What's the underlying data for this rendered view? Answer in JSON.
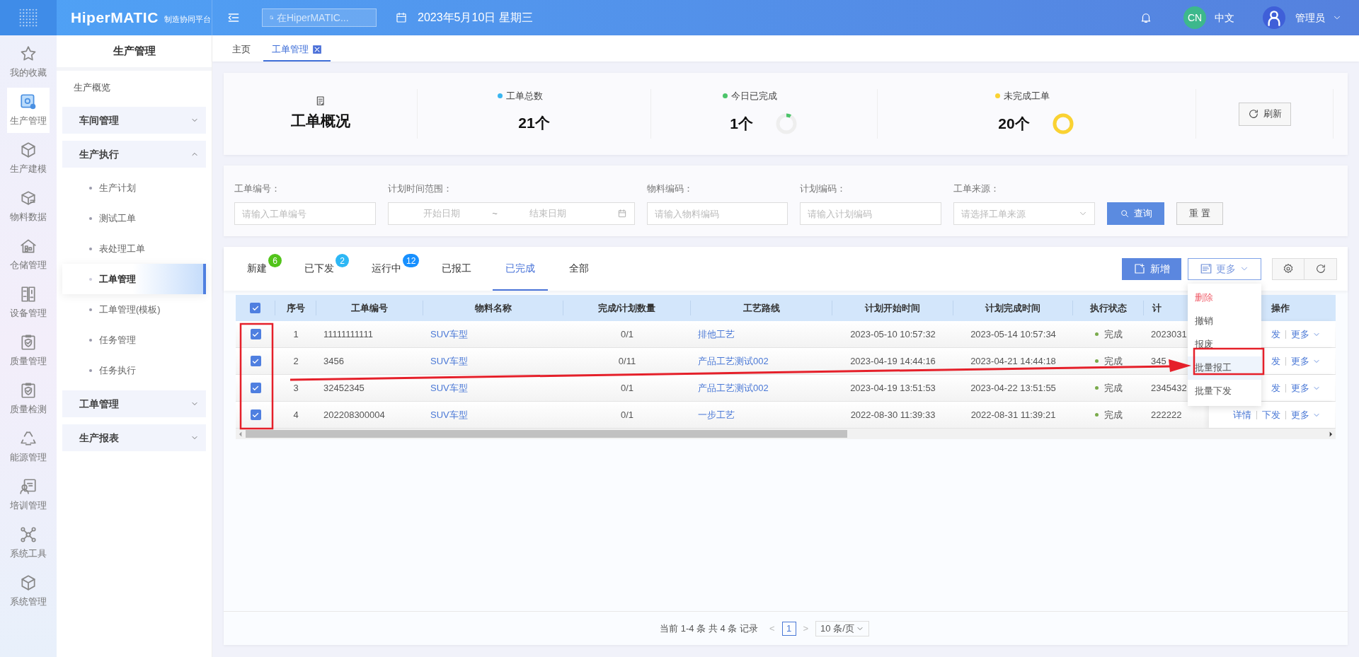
{
  "header": {
    "brand": "HiperMATIC",
    "brand_subtitle": "制造协同平台",
    "search": {
      "placeholder": "在HiperMATIC..."
    },
    "date": "2023年5月10日 星期三",
    "language_badge": "CN",
    "language": "中文",
    "user": "管理员"
  },
  "rail": [
    {
      "label": "我的收藏",
      "selected": false
    },
    {
      "label": "生产管理",
      "selected": true
    },
    {
      "label": "生产建模",
      "selected": false
    },
    {
      "label": "物料数据",
      "selected": false
    },
    {
      "label": "仓储管理",
      "selected": false
    },
    {
      "label": "设备管理",
      "selected": false
    },
    {
      "label": "质量管理",
      "selected": false
    },
    {
      "label": "质量检测",
      "selected": false
    },
    {
      "label": "能源管理",
      "selected": false
    },
    {
      "label": "培训管理",
      "selected": false
    },
    {
      "label": "系统工具",
      "selected": false
    },
    {
      "label": "系统管理",
      "selected": false
    }
  ],
  "sidebar": {
    "title": "生产管理",
    "items": [
      {
        "label": "生产概览",
        "kind": "link"
      },
      {
        "label": "车间管理",
        "kind": "group",
        "expanded": false
      },
      {
        "label": "生产执行",
        "kind": "group",
        "expanded": true,
        "children": [
          {
            "label": "生产计划",
            "selected": false
          },
          {
            "label": "测试工单",
            "selected": false
          },
          {
            "label": "表处理工单",
            "selected": false
          },
          {
            "label": "工单管理",
            "selected": true
          },
          {
            "label": "工单管理(模板)",
            "selected": false
          },
          {
            "label": "任务管理",
            "selected": false
          },
          {
            "label": "任务执行",
            "selected": false
          }
        ]
      },
      {
        "label": "工单管理",
        "kind": "group",
        "expanded": false
      },
      {
        "label": "生产报表",
        "kind": "group",
        "expanded": false
      }
    ]
  },
  "page_tabs": [
    {
      "label": "主页",
      "selected": false,
      "closable": false
    },
    {
      "label": "工单管理",
      "selected": true,
      "closable": true
    }
  ],
  "overview": {
    "title": "工单概况",
    "stats": [
      {
        "label": "工单总数",
        "value": "21个",
        "color": "#3ab5f0"
      },
      {
        "label": "今日已完成",
        "value": "1个",
        "color": "#4cc46a",
        "level": 0.08
      },
      {
        "label": "未完成工单",
        "value": "20个",
        "color": "#fad232",
        "level": 1
      }
    ],
    "refresh": "刷新"
  },
  "filters": [
    {
      "label": "工单编号：",
      "kind": "text",
      "placeholder": "请输入工单编号"
    },
    {
      "label": "计划时间范围：",
      "kind": "daterange",
      "start_placeholder": "开始日期",
      "separator": "~",
      "end_placeholder": "结束日期"
    },
    {
      "label": "物料编码：",
      "kind": "text",
      "placeholder": "请输入物料编码"
    },
    {
      "label": "计划编码：",
      "kind": "text",
      "placeholder": "请输入计划编码"
    },
    {
      "label": "工单来源：",
      "kind": "select",
      "placeholder": "请选择工单来源"
    }
  ],
  "filter_buttons": {
    "search": "查询",
    "reset": "重 置"
  },
  "status_tabs": [
    {
      "label": "新建",
      "badge": "6",
      "color": "#52c41a",
      "selected": false
    },
    {
      "label": "已下发",
      "badge": "2",
      "color": "#2db7f5",
      "selected": false
    },
    {
      "label": "运行中",
      "badge": "12",
      "color": "#1890ff",
      "selected": false
    },
    {
      "label": "已报工",
      "selected": false
    },
    {
      "label": "已完成",
      "selected": true
    },
    {
      "label": "全部",
      "selected": false
    }
  ],
  "toolbar": {
    "add": "新增",
    "more": "更多",
    "menu": [
      {
        "label": "删除",
        "kind": "danger",
        "highlighted": false
      },
      {
        "label": "撤销",
        "kind": "normal",
        "highlighted": false
      },
      {
        "label": "报废",
        "kind": "normal",
        "highlighted": false
      },
      {
        "label": "批量报工",
        "kind": "normal",
        "highlighted": true
      },
      {
        "label": "批量下发",
        "kind": "normal",
        "highlighted": false
      }
    ]
  },
  "table": {
    "all_checked": true,
    "columns": [
      "序号",
      "工单编号",
      "物料名称",
      "完成/计划数量",
      "工艺路线",
      "计划开始时间",
      "计划完成时间",
      "执行状态",
      "计",
      "操作"
    ],
    "rows": [
      {
        "checked": true,
        "seq": "1",
        "code": "11111111111",
        "material": "SUV车型",
        "quantity": "0/1",
        "route": "排他工艺",
        "start": "2023-05-10 10:57:32",
        "end": "2023-05-14 10:57:34",
        "status": "完成",
        "plan": "2023031",
        "actions": [
          "发",
          "更多"
        ]
      },
      {
        "checked": true,
        "seq": "2",
        "code": "3456",
        "material": "SUV车型",
        "quantity": "0/11",
        "route": "产品工艺测试002",
        "start": "2023-04-19 14:44:16",
        "end": "2023-04-21 14:44:18",
        "status": "完成",
        "plan": "345",
        "actions": [
          "发",
          "更多"
        ]
      },
      {
        "checked": true,
        "seq": "3",
        "code": "32452345",
        "material": "SUV车型",
        "quantity": "0/1",
        "route": "产品工艺测试002",
        "start": "2023-04-19 13:51:53",
        "end": "2023-04-22 13:51:55",
        "status": "完成",
        "plan": "2345432",
        "actions": [
          "发",
          "更多"
        ]
      },
      {
        "checked": true,
        "seq": "4",
        "code": "202208300004",
        "material": "SUV车型",
        "quantity": "0/1",
        "route": "一步工艺",
        "start": "2022-08-30 11:39:33",
        "end": "2022-08-31 11:39:21",
        "status": "完成",
        "plan": "222222",
        "actions": [
          "详情",
          "下发",
          "更多"
        ]
      }
    ]
  },
  "pagination": {
    "summary": "当前 1-4 条 共 4 条 记录",
    "prev": "<",
    "pages": [
      {
        "label": "1",
        "selected": true
      }
    ],
    "next": ">",
    "page_size": "10 条/页"
  }
}
